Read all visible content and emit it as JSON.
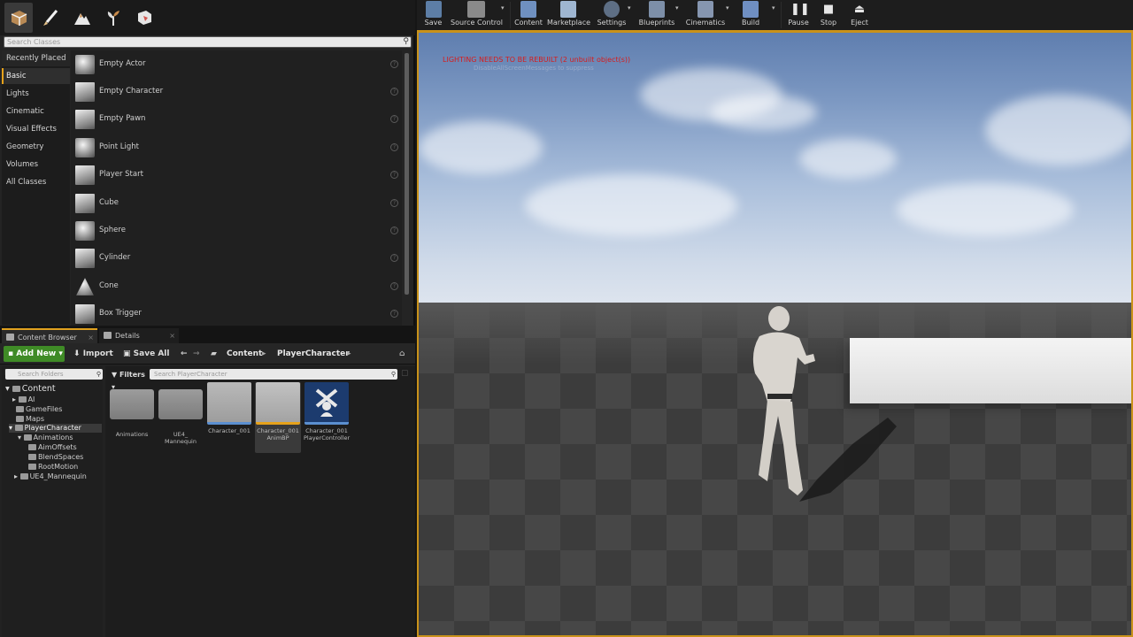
{
  "modes": {
    "icons": [
      "place-mode-icon",
      "paint-mode-icon",
      "landscape-mode-icon",
      "foliage-mode-icon",
      "geometry-mode-icon"
    ]
  },
  "place": {
    "search_placeholder": "Search Classes",
    "categories": [
      "Recently Placed",
      "Basic",
      "Lights",
      "Cinematic",
      "Visual Effects",
      "Geometry",
      "Volumes",
      "All Classes"
    ],
    "selected_category": "Basic",
    "items": [
      "Empty Actor",
      "Empty Character",
      "Empty Pawn",
      "Point Light",
      "Player Start",
      "Cube",
      "Sphere",
      "Cylinder",
      "Cone",
      "Box Trigger"
    ]
  },
  "toolbar": {
    "buttons": [
      "Save",
      "Source Control",
      "Content",
      "Marketplace",
      "Settings",
      "Blueprints",
      "Cinematics",
      "Build",
      "Pause",
      "Stop",
      "Eject"
    ]
  },
  "viewport": {
    "warning": "LIGHTING NEEDS TO BE REBUILT (2 unbuilt object(s))",
    "warning_sub": "DisableAllScreenMessages to suppress"
  },
  "tabs": {
    "content_browser": "Content Browser",
    "details": "Details"
  },
  "content_browser": {
    "add_new": "Add New",
    "import": "Import",
    "save_all": "Save All",
    "breadcrumb": [
      "Content",
      "PlayerCharacter"
    ],
    "search_folders_placeholder": "Search Folders",
    "filters": "Filters",
    "search_assets_placeholder": "Search PlayerCharacter",
    "tree": [
      "Content",
      "AI",
      "GameFiles",
      "Maps",
      "PlayerCharacter",
      "Animations",
      "AimOffsets",
      "BlendSpaces",
      "RootMotion",
      "UE4_Mannequin"
    ],
    "assets": [
      {
        "name": "Animations",
        "sub": ""
      },
      {
        "name": "UE4_",
        "sub": "Mannequin"
      },
      {
        "name": "Character_001",
        "sub": ""
      },
      {
        "name": "Character_001",
        "sub": "AnimBP"
      },
      {
        "name": "Character_001",
        "sub": "PlayerController"
      }
    ]
  },
  "colors": {
    "accent": "#e6a21b",
    "add_new": "#3f8b26",
    "warning": "#d61c1c"
  }
}
